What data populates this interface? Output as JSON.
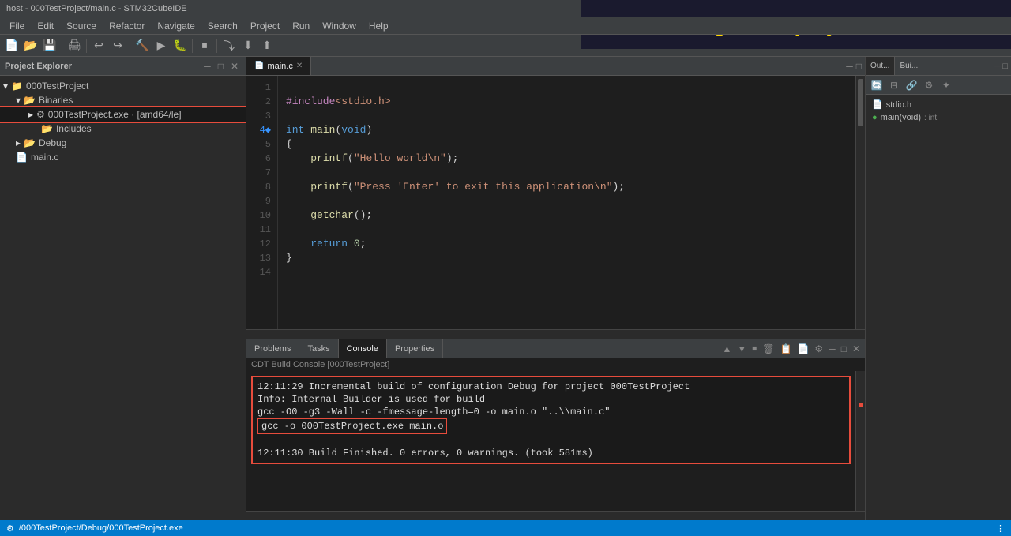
{
  "titlebar": {
    "title": "host - 000TestProject/main.c - STM32CubeIDE",
    "close": "✕",
    "minimize": "─",
    "maximize": "□"
  },
  "annotation": {
    "text": "Creating a new project for the HOST"
  },
  "menubar": {
    "items": [
      "File",
      "Edit",
      "Source",
      "Refactor",
      "Navigate",
      "Search",
      "Project",
      "Run",
      "Window",
      "Help"
    ]
  },
  "project_explorer": {
    "title": "Project Explorer",
    "close_icon": "✕",
    "tree": [
      {
        "indent": 0,
        "icon": "📁",
        "label": "000TestProject",
        "type": "project",
        "expanded": true
      },
      {
        "indent": 1,
        "icon": "📂",
        "label": "Binaries",
        "type": "folder",
        "expanded": true
      },
      {
        "indent": 2,
        "icon": "⚙",
        "label": "000TestProject.exe · [amd64/le]",
        "type": "binary",
        "highlighted": true
      },
      {
        "indent": 3,
        "icon": "📂",
        "label": "Includes",
        "type": "folder"
      },
      {
        "indent": 1,
        "icon": "📂",
        "label": "Debug",
        "type": "folder"
      },
      {
        "indent": 1,
        "icon": "📄",
        "label": "main.c",
        "type": "file"
      }
    ]
  },
  "editor": {
    "tab_label": "main.c",
    "lines": [
      {
        "num": 1,
        "content": ""
      },
      {
        "num": 2,
        "content": "#include<stdio.h>"
      },
      {
        "num": 3,
        "content": ""
      },
      {
        "num": 4,
        "content": "int main(void)",
        "breakpoint": true
      },
      {
        "num": 5,
        "content": "{"
      },
      {
        "num": 6,
        "content": "    printf(\"Hello world\\n\");"
      },
      {
        "num": 7,
        "content": ""
      },
      {
        "num": 8,
        "content": "    printf(\"Press 'Enter' to exit this application\\n\");"
      },
      {
        "num": 9,
        "content": ""
      },
      {
        "num": 10,
        "content": "    getchar();"
      },
      {
        "num": 11,
        "content": ""
      },
      {
        "num": 12,
        "content": "    return 0;"
      },
      {
        "num": 13,
        "content": "}"
      },
      {
        "num": 14,
        "content": ""
      }
    ]
  },
  "console": {
    "tabs": [
      "Problems",
      "Tasks",
      "Console",
      "Properties"
    ],
    "active_tab": "Console",
    "label": "CDT Build Console [000TestProject]",
    "lines": [
      "12:11:29  Incremental build of configuration Debug for project 000TestProject",
      "Info: Internal Builder is used for build",
      "gcc -O0 -g3 -Wall -c -fmessage-length=0 -o main.o \"..\\\\main.c\"",
      "gcc -o 000TestProject.exe main.o",
      "",
      "12:11:30 Build Finished. 0 errors, 0 warnings. (took 581ms)"
    ],
    "highlighted_lines": [
      3,
      4
    ]
  },
  "right_panel": {
    "tabs": [
      "Out...",
      "Bui..."
    ],
    "active_tab": "Out...",
    "toolbar_icons": [
      "sync",
      "collapse",
      "link",
      "settings"
    ],
    "outline": [
      {
        "icon": "📄",
        "label": "stdio.h",
        "type": ""
      },
      {
        "icon": "🔵",
        "label": "main(void)",
        "type": ": int"
      }
    ]
  },
  "statusbar": {
    "left": "/000TestProject/Debug/000TestProject.exe",
    "right": "●"
  }
}
